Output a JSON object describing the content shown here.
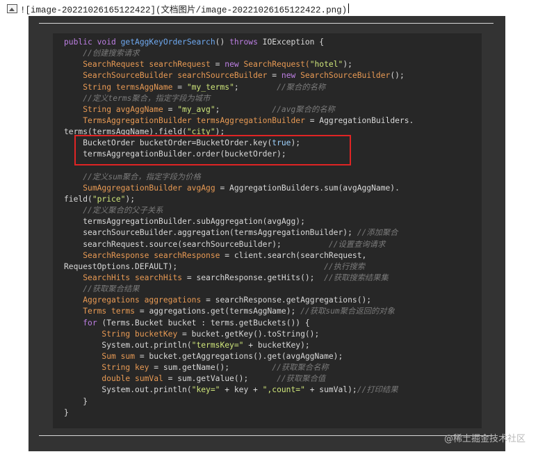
{
  "header": {
    "markdown_line": "![image-20221026165122422](文档图片/image-20221026165122422.png)"
  },
  "code_lines": [
    [
      {
        "t": "public void ",
        "c": "kw"
      },
      {
        "t": "getAggKeyOrderSearch",
        "c": "mth"
      },
      {
        "t": "() ",
        "c": "fn"
      },
      {
        "t": "throws ",
        "c": "kw"
      },
      {
        "t": "IOException {",
        "c": "fn"
      }
    ],
    [
      {
        "t": "    ",
        "c": "fn"
      },
      {
        "t": "//创建搜索请求",
        "c": "cm"
      }
    ],
    [
      {
        "t": "    ",
        "c": "fn"
      },
      {
        "t": "SearchRequest searchRequest",
        "c": "typ"
      },
      {
        "t": " = ",
        "c": "fn"
      },
      {
        "t": "new ",
        "c": "kw"
      },
      {
        "t": "SearchRequest(",
        "c": "typ"
      },
      {
        "t": "\"hotel\"",
        "c": "str"
      },
      {
        "t": ");",
        "c": "fn"
      }
    ],
    [
      {
        "t": "    ",
        "c": "fn"
      },
      {
        "t": "SearchSourceBuilder searchSourceBuilder",
        "c": "typ"
      },
      {
        "t": " = ",
        "c": "fn"
      },
      {
        "t": "new ",
        "c": "kw"
      },
      {
        "t": "SearchSourceBuilder",
        "c": "typ"
      },
      {
        "t": "();",
        "c": "fn"
      }
    ],
    [
      {
        "t": "    ",
        "c": "fn"
      },
      {
        "t": "String termsAggName",
        "c": "typ"
      },
      {
        "t": " = ",
        "c": "fn"
      },
      {
        "t": "\"my_terms\"",
        "c": "str"
      },
      {
        "t": ";        ",
        "c": "fn"
      },
      {
        "t": "//聚合的名称",
        "c": "cm"
      }
    ],
    [
      {
        "t": "    ",
        "c": "fn"
      },
      {
        "t": "//定义terms聚合，指定字段为城市",
        "c": "cm"
      }
    ],
    [
      {
        "t": "    ",
        "c": "fn"
      },
      {
        "t": "String avgAggName",
        "c": "typ"
      },
      {
        "t": " = ",
        "c": "fn"
      },
      {
        "t": "\"my_avg\"",
        "c": "str"
      },
      {
        "t": ";           ",
        "c": "fn"
      },
      {
        "t": "//avg聚合的名称",
        "c": "cm"
      }
    ],
    [
      {
        "t": "    ",
        "c": "fn"
      },
      {
        "t": "TermsAggregationBuilder termsAggregationBuilder",
        "c": "typ"
      },
      {
        "t": " = AggregationBuilders.",
        "c": "fn"
      }
    ],
    [
      {
        "t": "terms(termsAggName).field(",
        "c": "fn"
      },
      {
        "t": "\"city\"",
        "c": "str"
      },
      {
        "t": ");",
        "c": "fn"
      }
    ],
    [
      {
        "t": "    BucketOrder bucketOrder=BucketOrder.key(",
        "c": "fn"
      },
      {
        "t": "true",
        "c": "tru"
      },
      {
        "t": ");",
        "c": "fn"
      }
    ],
    [
      {
        "t": "    termsAggregationBuilder.order(bucketOrder);",
        "c": "fn"
      }
    ],
    [
      {
        "t": "",
        "c": "fn"
      }
    ],
    [
      {
        "t": "    ",
        "c": "fn"
      },
      {
        "t": "//定义sum聚合，指定字段为价格",
        "c": "cm"
      }
    ],
    [
      {
        "t": "    ",
        "c": "fn"
      },
      {
        "t": "SumAggregationBuilder avgAgg",
        "c": "typ"
      },
      {
        "t": " = AggregationBuilders.sum(avgAggName).",
        "c": "fn"
      }
    ],
    [
      {
        "t": "field(",
        "c": "fn"
      },
      {
        "t": "\"price\"",
        "c": "str"
      },
      {
        "t": ");",
        "c": "fn"
      }
    ],
    [
      {
        "t": "    ",
        "c": "fn"
      },
      {
        "t": "//定义聚合的父子关系",
        "c": "cm"
      }
    ],
    [
      {
        "t": "    termsAggregationBuilder.subAggregation(avgAgg);",
        "c": "fn"
      }
    ],
    [
      {
        "t": "    searchSourceBuilder.aggregation(termsAggregationBuilder); ",
        "c": "fn"
      },
      {
        "t": "//添加聚合",
        "c": "cm"
      }
    ],
    [
      {
        "t": "    searchRequest.source(searchSourceBuilder);          ",
        "c": "fn"
      },
      {
        "t": "//设置查询请求",
        "c": "cm"
      }
    ],
    [
      {
        "t": "    ",
        "c": "fn"
      },
      {
        "t": "SearchResponse searchResponse",
        "c": "typ"
      },
      {
        "t": " = client.search(searchRequest,",
        "c": "fn"
      }
    ],
    [
      {
        "t": "RequestOptions.DEFAULT);                               ",
        "c": "fn"
      },
      {
        "t": "//执行搜索",
        "c": "cm"
      }
    ],
    [
      {
        "t": "    ",
        "c": "fn"
      },
      {
        "t": "SearchHits searchHits",
        "c": "typ"
      },
      {
        "t": " = searchResponse.getHits();  ",
        "c": "fn"
      },
      {
        "t": "//获取搜索结果集",
        "c": "cm"
      }
    ],
    [
      {
        "t": "    ",
        "c": "fn"
      },
      {
        "t": "//获取聚合结果",
        "c": "cm"
      }
    ],
    [
      {
        "t": "    ",
        "c": "fn"
      },
      {
        "t": "Aggregations aggregations",
        "c": "typ"
      },
      {
        "t": " = searchResponse.getAggregations();",
        "c": "fn"
      }
    ],
    [
      {
        "t": "    ",
        "c": "fn"
      },
      {
        "t": "Terms terms",
        "c": "typ"
      },
      {
        "t": " = aggregations.get(termsAggName); ",
        "c": "fn"
      },
      {
        "t": "//获取sum聚合返回的对象",
        "c": "cm"
      }
    ],
    [
      {
        "t": "    ",
        "c": "fn"
      },
      {
        "t": "for ",
        "c": "kw"
      },
      {
        "t": "(Terms.Bucket bucket : terms.getBuckets()) {",
        "c": "fn"
      }
    ],
    [
      {
        "t": "        ",
        "c": "fn"
      },
      {
        "t": "String bucketKey",
        "c": "typ"
      },
      {
        "t": " = bucket.getKey().toString();",
        "c": "fn"
      }
    ],
    [
      {
        "t": "        System.out.println(",
        "c": "fn"
      },
      {
        "t": "\"termsKey=\"",
        "c": "str"
      },
      {
        "t": " + bucketKey);",
        "c": "fn"
      }
    ],
    [
      {
        "t": "        ",
        "c": "fn"
      },
      {
        "t": "Sum sum",
        "c": "typ"
      },
      {
        "t": " = bucket.getAggregations().get(avgAggName);",
        "c": "fn"
      }
    ],
    [
      {
        "t": "        ",
        "c": "fn"
      },
      {
        "t": "String key",
        "c": "typ"
      },
      {
        "t": " = sum.getName();         ",
        "c": "fn"
      },
      {
        "t": "//获取聚合名称",
        "c": "cm"
      }
    ],
    [
      {
        "t": "        ",
        "c": "fn"
      },
      {
        "t": "double sumVal",
        "c": "typ"
      },
      {
        "t": " = sum.getValue();      ",
        "c": "fn"
      },
      {
        "t": "//获取聚合值",
        "c": "cm"
      }
    ],
    [
      {
        "t": "        System.out.println(",
        "c": "fn"
      },
      {
        "t": "\"key=\"",
        "c": "str"
      },
      {
        "t": " + key + ",
        "c": "fn"
      },
      {
        "t": "\",count=\"",
        "c": "str"
      },
      {
        "t": " + sumVal);",
        "c": "fn"
      },
      {
        "t": "//打印结果",
        "c": "cm"
      }
    ],
    [
      {
        "t": "    }",
        "c": "fn"
      }
    ],
    [
      {
        "t": "}",
        "c": "fn"
      }
    ]
  ],
  "watermark": "@稀土掘金技术社区"
}
